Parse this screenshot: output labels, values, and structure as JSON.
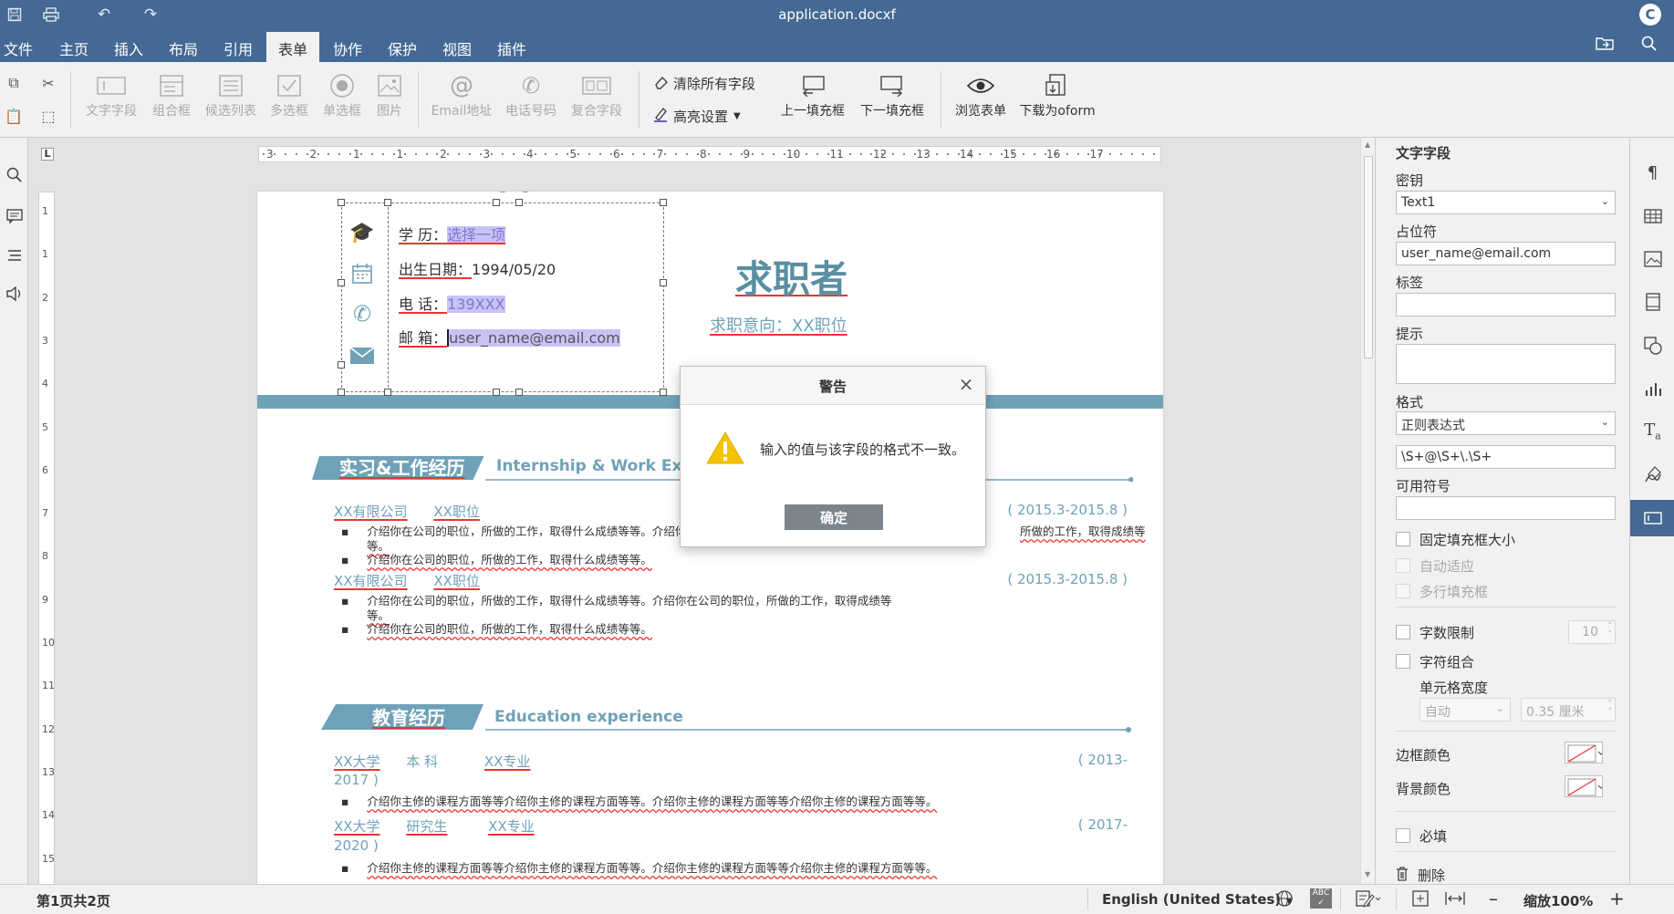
{
  "titlebar": {
    "title": "application.docxf",
    "avatar": "C"
  },
  "menu": [
    "文件",
    "主页",
    "插入",
    "布局",
    "引用",
    "表单",
    "协作",
    "保护",
    "视图",
    "插件"
  ],
  "toolbar": {
    "fields": [
      "文字字段",
      "组合框",
      "候选列表",
      "多选框",
      "单选框",
      "图片",
      "Email地址",
      "电话号码",
      "复合字段"
    ],
    "clear_all": "清除所有字段",
    "highlight": "高亮设置",
    "prev": "上一填充框",
    "next": "下一填充框",
    "view": "浏览表单",
    "download": "下载为oform"
  },
  "ruler": {
    "h": [
      "3",
      "2",
      "1",
      "1",
      "2",
      "3",
      "4",
      "5",
      "6",
      "7",
      "8",
      "9",
      "10",
      "11",
      "12",
      "13",
      "14",
      "15",
      "16",
      "17"
    ],
    "v": [
      "1",
      "1",
      "2",
      "3",
      "4",
      "5",
      "6",
      "7",
      "8",
      "9",
      "10",
      "11",
      "12",
      "13",
      "14",
      "15"
    ]
  },
  "document": {
    "info": {
      "edu_label": "学 历：",
      "edu_value": "选择一项",
      "dob_label": "出生日期：",
      "dob_value": "1994/05/20",
      "phone_label": "电 话：",
      "phone_value": "139XXX",
      "email_label": "邮 箱：",
      "email_value": "user_name@email.com"
    },
    "name": "求职者",
    "intent_label": "求职意向：",
    "intent_value": "XX职位",
    "section1_cn": "实习&工作经历",
    "section1_en": "Internship & Work Ex",
    "jobs": [
      {
        "company": "XX有限公司",
        "position": "XX职位",
        "date": "( 2015.3-2015.8 )",
        "b1a": "介绍你在公司的职位，所做的工作，取得什么成绩等等。介绍你在公司的职位，所做的工作，取得什么成绩等等。介",
        "b1tail": "所做的工作，取得成绩等",
        "b1c": "等。",
        "b2": "介绍你在公司的职位，所做的工作，取得什么成绩等等。"
      },
      {
        "company": "XX有限公司",
        "position": "XX职位",
        "date": "( 2015.3-2015.8 )",
        "b1a": "介绍你在公司的职位，所做的工作，取得什么成绩等等。介绍你在公司的职位，所做的工作，取得成绩等",
        "b1tail": "",
        "b1c": "等。",
        "b2": "介绍你在公司的职位，所做的工作，取得什么成绩等等。"
      }
    ],
    "section2_cn": "教育经历",
    "section2_en": "Education experience",
    "edu": [
      {
        "school": "XX大学",
        "degree": "本 科",
        "major": "XX专业",
        "date1": "( 2013-",
        "date2": "2017 )",
        "b": "介绍你主修的课程方面等等介绍你主修的课程方面等等。介绍你主修的课程方面等等介绍你主修的课程方面等等。"
      },
      {
        "school": "XX大学",
        "degree": "研究生",
        "major": "XX专业",
        "date1": "( 2017-",
        "date2": "2020 )",
        "b": "介绍你主修的课程方面等等介绍你主修的课程方面等等。介绍你主修的课程方面等等介绍你主修的课程方面等等。"
      }
    ]
  },
  "dialog": {
    "title": "警告",
    "message": "输入的值与该字段的格式不一致。",
    "ok": "确定"
  },
  "panel": {
    "title": "文字字段",
    "key_label": "密钥",
    "key_value": "Text1",
    "placeholder_label": "占位符",
    "placeholder_value": "user_name@email.com",
    "tag_label": "标签",
    "tag_value": "",
    "tip_label": "提示",
    "tip_value": "",
    "format_label": "格式",
    "format_value": "正则表达式",
    "regex_value": "\\S+@\\S+\\.\\S+",
    "allowed_label": "可用符号",
    "allowed_value": "",
    "fixed_label": "固定填充框大小",
    "autofit_label": "自动适应",
    "multiline_label": "多行填充框",
    "limit_label": "字数限制",
    "limit_value": "10",
    "comb_label": "字符组合",
    "cell_width_label": "单元格宽度",
    "cell_auto": "自动",
    "cell_width_value": "0.35 厘米",
    "border_color_label": "边框颜色",
    "bg_color_label": "背景颜色",
    "required_label": "必填",
    "delete_label": "删除"
  },
  "status": {
    "page": "第1页共2页",
    "language": "English (United States)",
    "zoom": "缩放100%"
  },
  "colors": {
    "brand": "#446995",
    "accent": "#6fa2b8",
    "title": "#5a8fa3"
  }
}
